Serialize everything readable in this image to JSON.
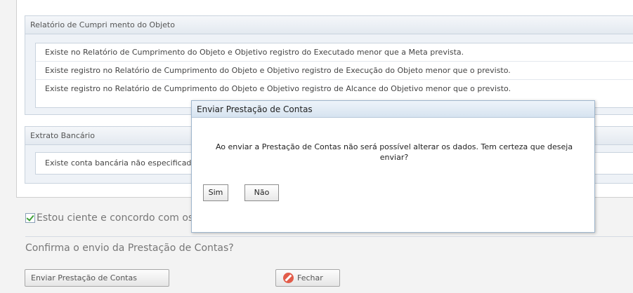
{
  "report_section": {
    "title": "Relatório de Cumpri mento do Objeto",
    "rows": [
      "Existe no Relatório de Cumprimento do Objeto e Objetivo registro do Executado menor que a Meta prevista.",
      "Existe registro no Relatório de Cumprimento do Objeto e Objetivo registro de Execução do Objeto menor que o previsto.",
      "Existe registro no Relatório de Cumprimento do Objeto e Objetivo registro de Alcance do Objetivo menor que o previsto."
    ]
  },
  "bank_section": {
    "title": "Extrato Bancário",
    "rows": [
      "Existe conta bancária não especificada."
    ]
  },
  "agree": {
    "checked": true,
    "label": "Estou ciente e concordo com os termos."
  },
  "confirm_question": "Confirma o envio da Prestação de Contas?",
  "buttons": {
    "send": "Enviar Prestação de Contas",
    "close": "Fechar"
  },
  "dialog": {
    "title": "Enviar Prestação de Contas",
    "message": "Ao enviar a Prestação de Contas não será possível alterar os dados. Tem certeza que deseja enviar?",
    "yes": "Sim",
    "no": "Não"
  }
}
